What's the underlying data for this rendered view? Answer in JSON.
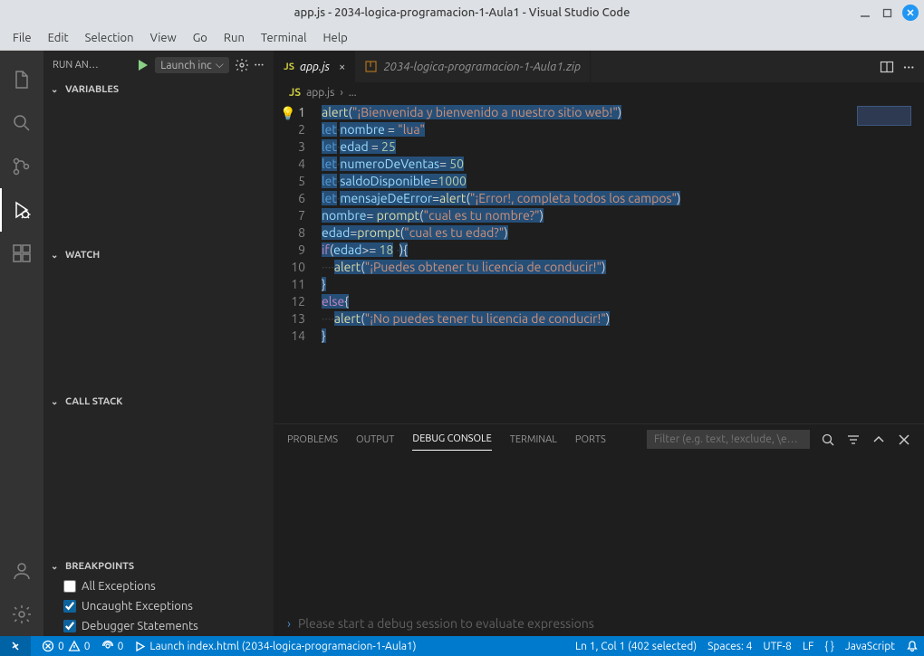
{
  "titlebar": {
    "title": "app.js - 2034-logica-programacion-1-Aula1 - Visual Studio Code"
  },
  "menu": [
    "File",
    "Edit",
    "Selection",
    "View",
    "Go",
    "Run",
    "Terminal",
    "Help"
  ],
  "sidebar": {
    "title": "RUN AN…",
    "launch_config": "Launch inc",
    "sections": {
      "variables": "VARIABLES",
      "watch": "WATCH",
      "callstack": "CALL STACK",
      "breakpoints": "BREAKPOINTS"
    },
    "breakpoints": [
      {
        "label": "All Exceptions",
        "checked": false
      },
      {
        "label": "Uncaught Exceptions",
        "checked": true
      },
      {
        "label": "Debugger Statements",
        "checked": true
      }
    ]
  },
  "tabs": [
    {
      "icon": "JS",
      "label": "app.js",
      "active": true,
      "close": true
    },
    {
      "icon": "zip",
      "label": "2034-logica-programacion-1-Aula1.zip",
      "active": false,
      "close": false
    }
  ],
  "breadcrumb": {
    "file": "app.js",
    "sep": "›",
    "rest": "..."
  },
  "code_lines": [
    {
      "n": 1,
      "cur": true,
      "tokens": [
        [
          "fn",
          "alert"
        ],
        [
          "p",
          "("
        ],
        [
          "s",
          "\"¡Bienvenida y bienvenido a nuestro sitio web!\""
        ],
        [
          "p",
          ")"
        ]
      ]
    },
    {
      "n": 2,
      "tokens": [
        [
          "k",
          "let"
        ],
        [
          "ws",
          "·"
        ],
        [
          "v",
          "nombre"
        ],
        [
          "p",
          " = "
        ],
        [
          "s",
          "\"lua\""
        ]
      ]
    },
    {
      "n": 3,
      "tokens": [
        [
          "k",
          "let"
        ],
        [
          "ws",
          "·"
        ],
        [
          "v",
          "edad"
        ],
        [
          "p",
          " = "
        ],
        [
          "n",
          "25"
        ]
      ]
    },
    {
      "n": 4,
      "tokens": [
        [
          "k",
          "let"
        ],
        [
          "ws",
          "·"
        ],
        [
          "v",
          "numeroDeVentas"
        ],
        [
          "p",
          "= "
        ],
        [
          "n",
          "50"
        ]
      ]
    },
    {
      "n": 5,
      "tokens": [
        [
          "k",
          "let"
        ],
        [
          "ws",
          "·"
        ],
        [
          "v",
          "saldoDisponible"
        ],
        [
          "p",
          "="
        ],
        [
          "n",
          "1000"
        ]
      ]
    },
    {
      "n": 6,
      "tokens": [
        [
          "k",
          "let"
        ],
        [
          "ws",
          "·"
        ],
        [
          "v",
          "mensajeDeError"
        ],
        [
          "p",
          "="
        ],
        [
          "fn",
          "alert"
        ],
        [
          "p",
          "("
        ],
        [
          "s",
          "\"¡Error!, completa todos los campos\""
        ],
        [
          "p",
          ")"
        ]
      ]
    },
    {
      "n": 7,
      "tokens": [
        [
          "v",
          "nombre"
        ],
        [
          "p",
          "= "
        ],
        [
          "fn",
          "prompt"
        ],
        [
          "p",
          "("
        ],
        [
          "s",
          "\"cual es tu nombre?\""
        ],
        [
          "p",
          ")"
        ]
      ]
    },
    {
      "n": 8,
      "tokens": [
        [
          "v",
          "edad"
        ],
        [
          "p",
          "="
        ],
        [
          "fn",
          "prompt"
        ],
        [
          "p",
          "("
        ],
        [
          "s",
          "\"cual es tu edad?\""
        ],
        [
          "p",
          ")"
        ]
      ]
    },
    {
      "n": 9,
      "tokens": [
        [
          "kw2",
          "if"
        ],
        [
          "p",
          "("
        ],
        [
          "v",
          "edad"
        ],
        [
          "p",
          ">= "
        ],
        [
          "n",
          "18"
        ],
        [
          "ws",
          " ·"
        ],
        [
          "p",
          "){"
        ]
      ]
    },
    {
      "n": 10,
      "tokens": [
        [
          "ws",
          "····"
        ],
        [
          "fn",
          "alert"
        ],
        [
          "p",
          "("
        ],
        [
          "s",
          "\"¡Puedes obtener tu licencia de conducir!\""
        ],
        [
          "p",
          ")"
        ]
      ]
    },
    {
      "n": 11,
      "tokens": [
        [
          "p",
          "}"
        ]
      ]
    },
    {
      "n": 12,
      "tokens": [
        [
          "kw2",
          "else"
        ],
        [
          "p",
          "{"
        ]
      ]
    },
    {
      "n": 13,
      "tokens": [
        [
          "ws",
          "····"
        ],
        [
          "fn",
          "alert"
        ],
        [
          "p",
          "("
        ],
        [
          "s",
          "\"¡No puedes tener tu licencia de conducir!\""
        ],
        [
          "p",
          ")"
        ]
      ]
    },
    {
      "n": 14,
      "tokens": [
        [
          "p",
          "}"
        ]
      ]
    }
  ],
  "panel": {
    "tabs": [
      "PROBLEMS",
      "OUTPUT",
      "DEBUG CONSOLE",
      "TERMINAL",
      "PORTS"
    ],
    "active": "DEBUG CONSOLE",
    "filter_placeholder": "Filter (e.g. text, !exclude, \\e…",
    "prompt": "Please start a debug session to evaluate expressions"
  },
  "status": {
    "errors": "0",
    "warnings": "0",
    "ports": "0",
    "launch": "Launch index.html (2034-logica-programacion-1-Aula1)",
    "selection": "Ln 1, Col 1 (402 selected)",
    "spaces": "Spaces: 4",
    "encoding": "UTF-8",
    "eol": "LF",
    "braces": "{ }",
    "lang": "JavaScript"
  }
}
